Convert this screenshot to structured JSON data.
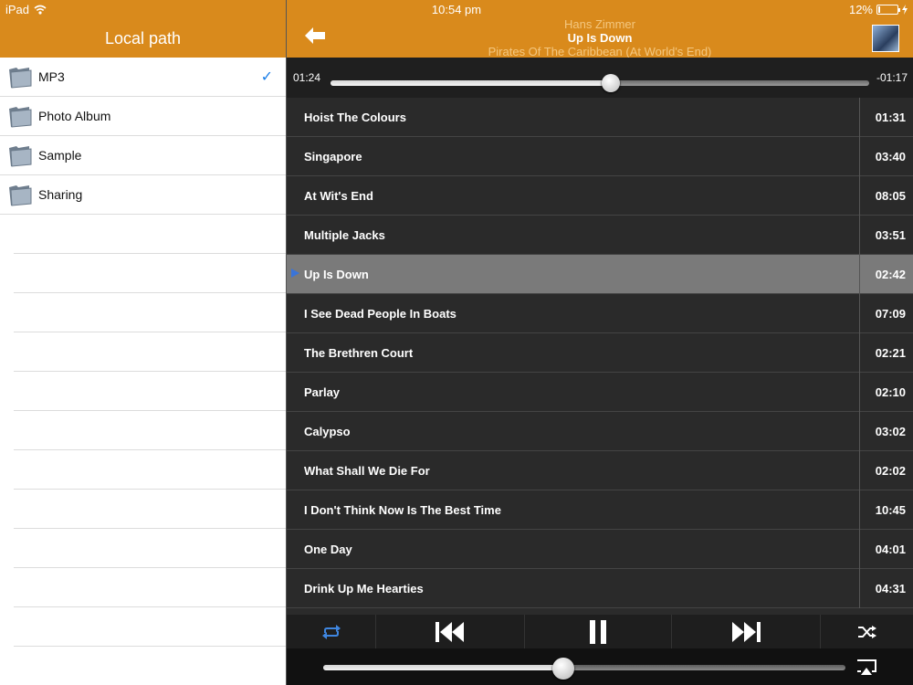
{
  "status": {
    "device": "iPad",
    "time": "10:54 pm",
    "battery_text": "12%",
    "battery_level": 0.12
  },
  "sidebar": {
    "title": "Local path",
    "folders": [
      {
        "label": "MP3",
        "selected": true
      },
      {
        "label": "Photo Album",
        "selected": false
      },
      {
        "label": "Sample",
        "selected": false
      },
      {
        "label": "Sharing",
        "selected": false
      }
    ]
  },
  "now_playing": {
    "artist": "Hans Zimmer",
    "title": "Up Is Down",
    "album": "Pirates Of The Caribbean (At World's End)",
    "elapsed": "01:24",
    "remaining": "-01:17",
    "progress": 0.52
  },
  "tracks": [
    {
      "name": "Hoist The Colours",
      "duration": "01:31"
    },
    {
      "name": "Singapore",
      "duration": "03:40"
    },
    {
      "name": "At Wit's End",
      "duration": "08:05"
    },
    {
      "name": "Multiple Jacks",
      "duration": "03:51"
    },
    {
      "name": "Up Is Down",
      "duration": "02:42",
      "current": true
    },
    {
      "name": "I See Dead People In Boats",
      "duration": "07:09"
    },
    {
      "name": "The Brethren Court",
      "duration": "02:21"
    },
    {
      "name": "Parlay",
      "duration": "02:10"
    },
    {
      "name": "Calypso",
      "duration": "03:02"
    },
    {
      "name": "What Shall We Die For",
      "duration": "02:02"
    },
    {
      "name": "I Don't Think Now Is The Best Time",
      "duration": "10:45"
    },
    {
      "name": "One Day",
      "duration": "04:01"
    },
    {
      "name": "Drink Up Me Hearties",
      "duration": "04:31"
    }
  ],
  "volume": {
    "level": 0.46
  },
  "colors": {
    "accent": "#d98a1c",
    "current_track": "#7a7a7a",
    "play_marker": "#3a74d8",
    "checkmark": "#1a7ee8"
  },
  "icons": {
    "back": "arrow-left-icon",
    "repeat": "repeat-icon",
    "previous": "skip-previous-icon",
    "pause": "pause-icon",
    "next": "skip-next-icon",
    "shuffle": "shuffle-icon",
    "airplay": "airplay-icon",
    "folder": "folder-icon",
    "check": "checkmark-icon"
  }
}
